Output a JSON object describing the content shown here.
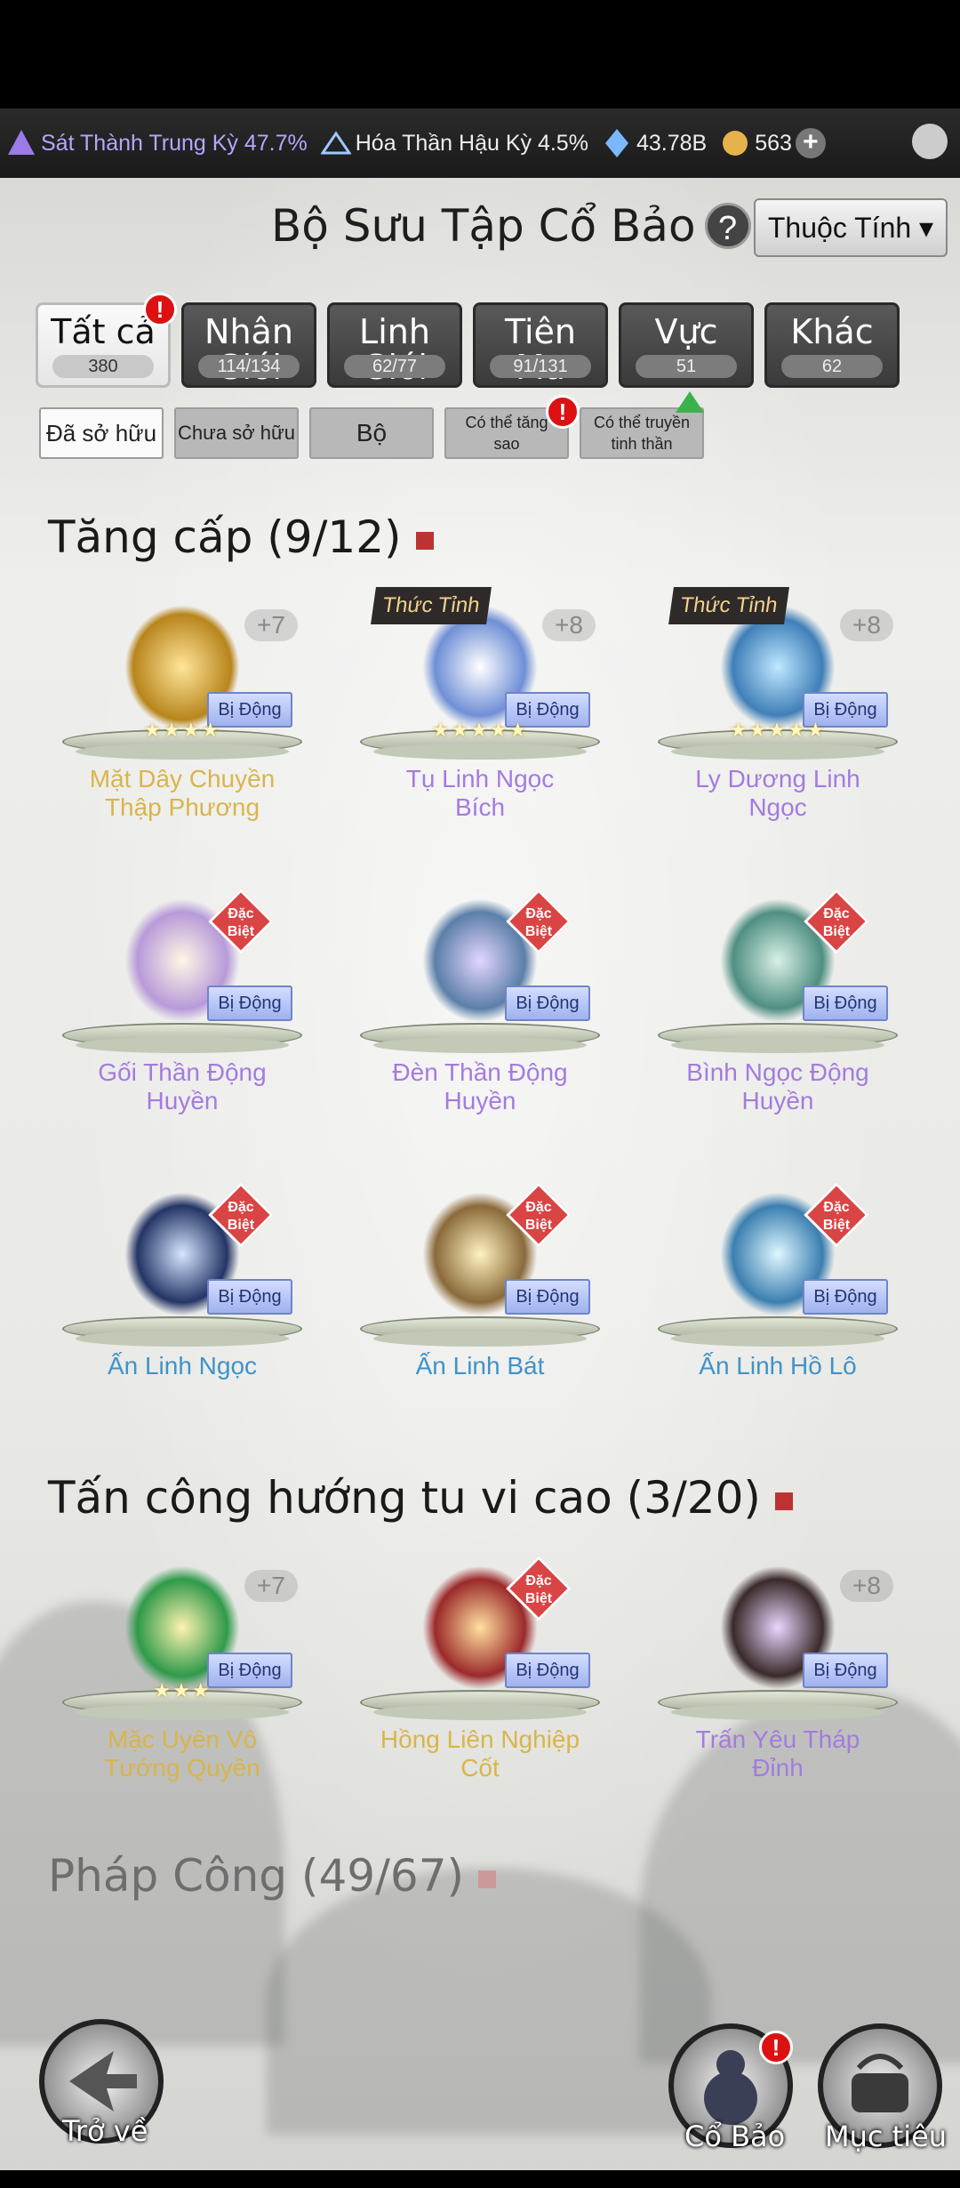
{
  "resources": {
    "realm1": "Sát Thành Trung Kỳ 47.7%",
    "realm2": "Hóa Thần Hậu Kỳ 4.5%",
    "crystals": "43.78B",
    "coins": "563"
  },
  "header": {
    "title": "Bộ Sưu Tập Cổ Bảo",
    "attr_button": "Thuộc Tính ▾"
  },
  "tabs": [
    {
      "label": "Tất cả",
      "count": "380"
    },
    {
      "label": "Nhân Giới",
      "count": "114/134"
    },
    {
      "label": "Linh Giới",
      "count": "62/77"
    },
    {
      "label": "Tiên Ma",
      "count": "91/131"
    },
    {
      "label": "Vực",
      "count": "51"
    },
    {
      "label": "Khác",
      "count": "62"
    }
  ],
  "filters": {
    "owned": "Đã sở hữu",
    "not_owned": "Chưa sở hữu",
    "set": "Bộ",
    "can_star": "Có thể tăng\nsao",
    "can_pass": "Có thể truyền\ntinh thần"
  },
  "sections": {
    "s1": "Tăng cấp (9/12)",
    "s2": "Tấn công hướng tu vi cao (3/20)",
    "s3": "Pháp Công (49/67)"
  },
  "labels": {
    "passive": "Bị Động",
    "awaken": "Thức Tỉnh",
    "special": "Đặc Biệt"
  },
  "items": [
    {
      "name": "Mặt Dây Chuyền\nThập Phương",
      "plus": "+7",
      "stars": "★★★★"
    },
    {
      "name": "Tụ Linh Ngọc\nBích",
      "plus": "+8",
      "stars": "★★★★★"
    },
    {
      "name": "Ly Dương Linh\nNgọc",
      "plus": "+8",
      "stars": "★★★★★"
    },
    {
      "name": "Gối Thần Động\nHuyền"
    },
    {
      "name": "Đèn Thần Động\nHuyền"
    },
    {
      "name": "Bình Ngọc Động\nHuyền"
    },
    {
      "name": "Ấn Linh Ngọc"
    },
    {
      "name": "Ấn Linh Bát"
    },
    {
      "name": "Ấn Linh Hồ Lô"
    },
    {
      "name": "Mặc Uyên Vô\nTướng Quyền",
      "plus": "+7",
      "stars": "★★★"
    },
    {
      "name": "Hồng Liên Nghiệp\nCốt"
    },
    {
      "name": "Trấn Yêu Tháp\nĐỉnh",
      "plus": "+8"
    }
  ],
  "bottom": {
    "back": "Trở về",
    "relic": "Cổ Bảo",
    "goal": "Mục tiêu"
  }
}
